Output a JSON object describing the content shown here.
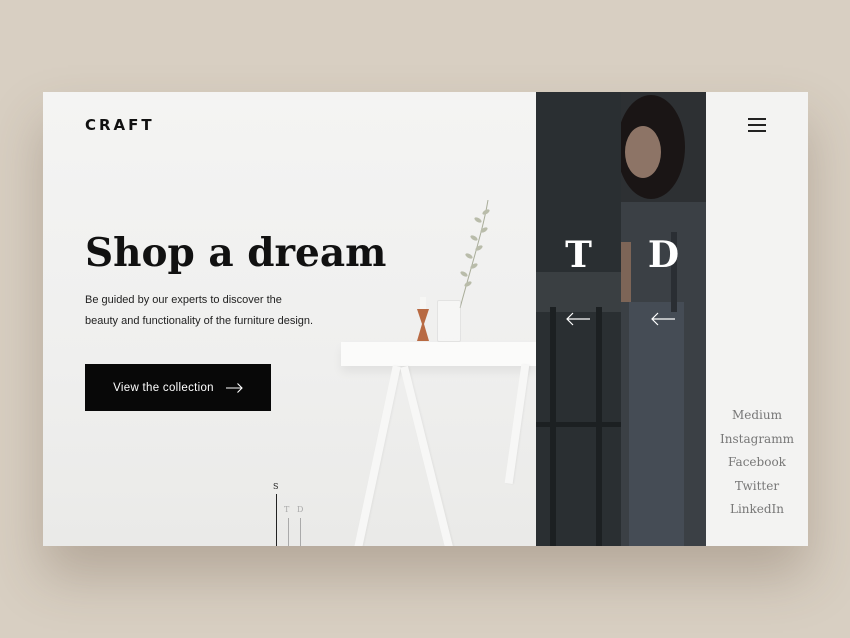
{
  "brand": {
    "logo": "CRAFT"
  },
  "hero": {
    "headline": "Shop a dream",
    "subtext_line1": "Be guided by our experts to discover the",
    "subtext_line2": "beauty and functionality of the furniture design.",
    "cta_label": "View the collection"
  },
  "slider": {
    "indicator": [
      "S",
      "T",
      "D"
    ],
    "active_index": 0,
    "panels": [
      {
        "letter": "T"
      },
      {
        "letter": "D"
      }
    ]
  },
  "social": [
    "Medium",
    "Instagramm",
    "Facebook",
    "Twitter",
    "LinkedIn"
  ],
  "icons": {
    "menu": "hamburger-icon",
    "cta": "arrow-right-icon",
    "panel": "arrow-left-icon"
  },
  "colors": {
    "page_background": "#d8cfc2",
    "card_background": "#f1f1f0",
    "cta_background": "#080808",
    "panel_dark": "#2a2f32",
    "social_text": "#777777"
  }
}
